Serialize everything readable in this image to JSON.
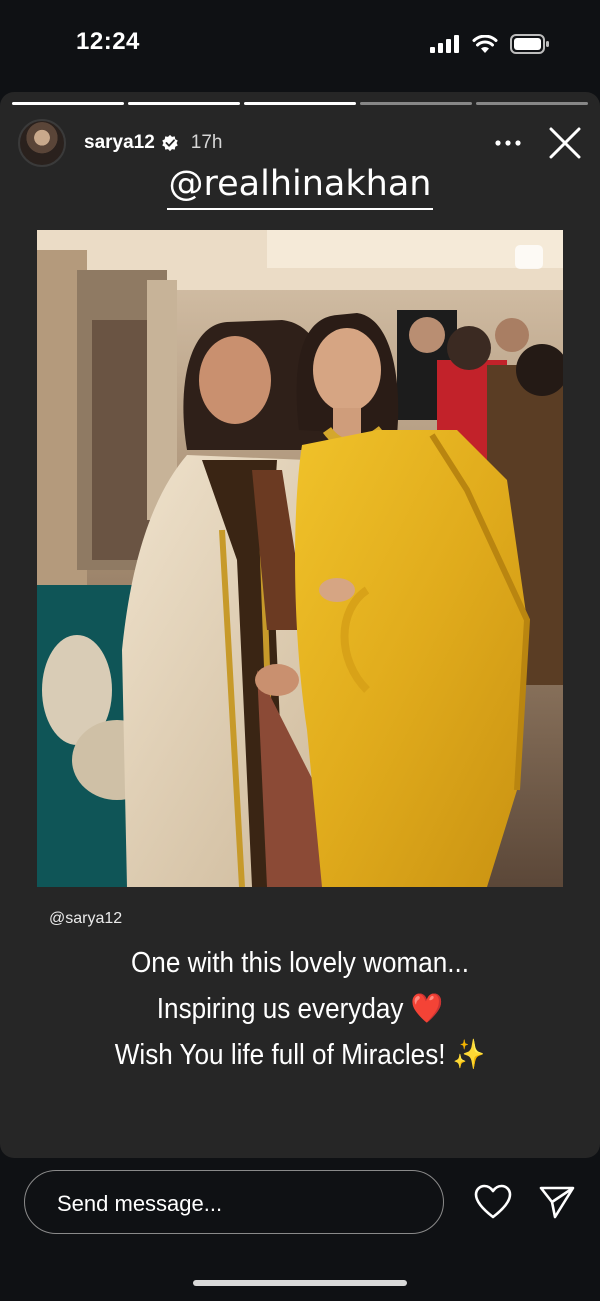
{
  "status_bar": {
    "time": "12:24"
  },
  "story": {
    "progress_total": 5,
    "progress_complete": 3,
    "username": "sarya12",
    "time_ago": "17h",
    "mention": "@realhinakhan",
    "photo_alt": "",
    "handle": "@sarya12",
    "caption_lines": [
      "One with this lovely woman...",
      "Inspiring us everyday ❤️",
      "Wish You life full of Miracles! ✨"
    ]
  },
  "bottom_bar": {
    "message_placeholder": "Send message..."
  },
  "icons": {
    "signal": "signal-icon",
    "wifi": "wifi-icon",
    "battery": "battery-icon",
    "verified": "verified-badge-icon",
    "more": "more-options-icon",
    "close": "close-icon",
    "like": "heart-icon",
    "share": "send-icon"
  },
  "colors": {
    "background": "#0f1114",
    "card": "#262626",
    "verified": "#ffffff",
    "heart_emoji": "#e0202a"
  }
}
